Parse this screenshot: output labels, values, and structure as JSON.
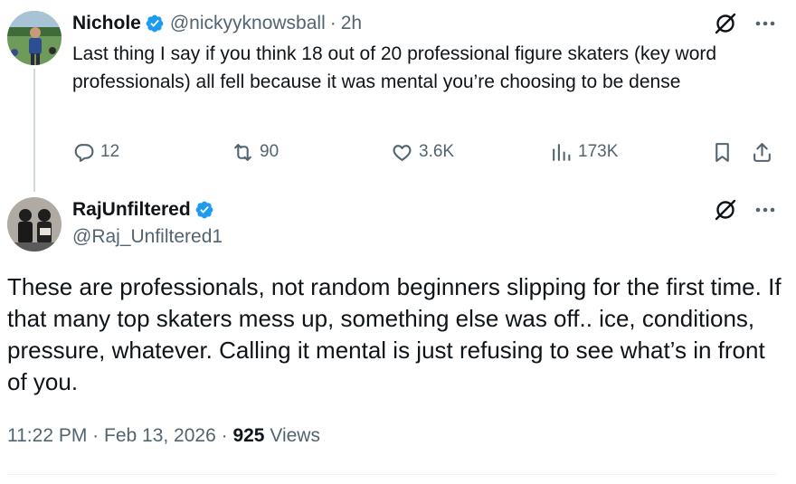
{
  "reply_tweet": {
    "display_name": "Nichole",
    "handle": "@nickyyknowsball",
    "separator": "·",
    "time": "2h",
    "text": "Last thing I say if you think 18 out of 20 professional figure skaters (key word professionals) all fell because it was mental you’re choosing to be dense",
    "metrics": {
      "replies": "12",
      "reposts": "90",
      "likes": "3.6K",
      "views": "173K"
    }
  },
  "main_tweet": {
    "display_name": "RajUnfiltered",
    "handle": "@Raj_Unfiltered1",
    "text": "These are professionals, not random beginners slipping for the first time. If that many top skaters mess up, something else was off.. ice, conditions, pressure, whatever. Calling it mental is just refusing to see what’s in front of you.",
    "timestamp": "11:22 PM · Feb 13, 2026 ·",
    "views_count": "925",
    "views_label": "Views"
  },
  "colors": {
    "verified": "#1d9bf0",
    "text_primary": "#0f1419",
    "text_secondary": "#536471",
    "thread_line": "#cfd9de"
  },
  "icons": [
    "reply-icon",
    "repost-icon",
    "like-icon",
    "views-icon",
    "bookmark-icon",
    "share-icon",
    "grok-icon",
    "more-icon",
    "verified-badge-icon"
  ]
}
